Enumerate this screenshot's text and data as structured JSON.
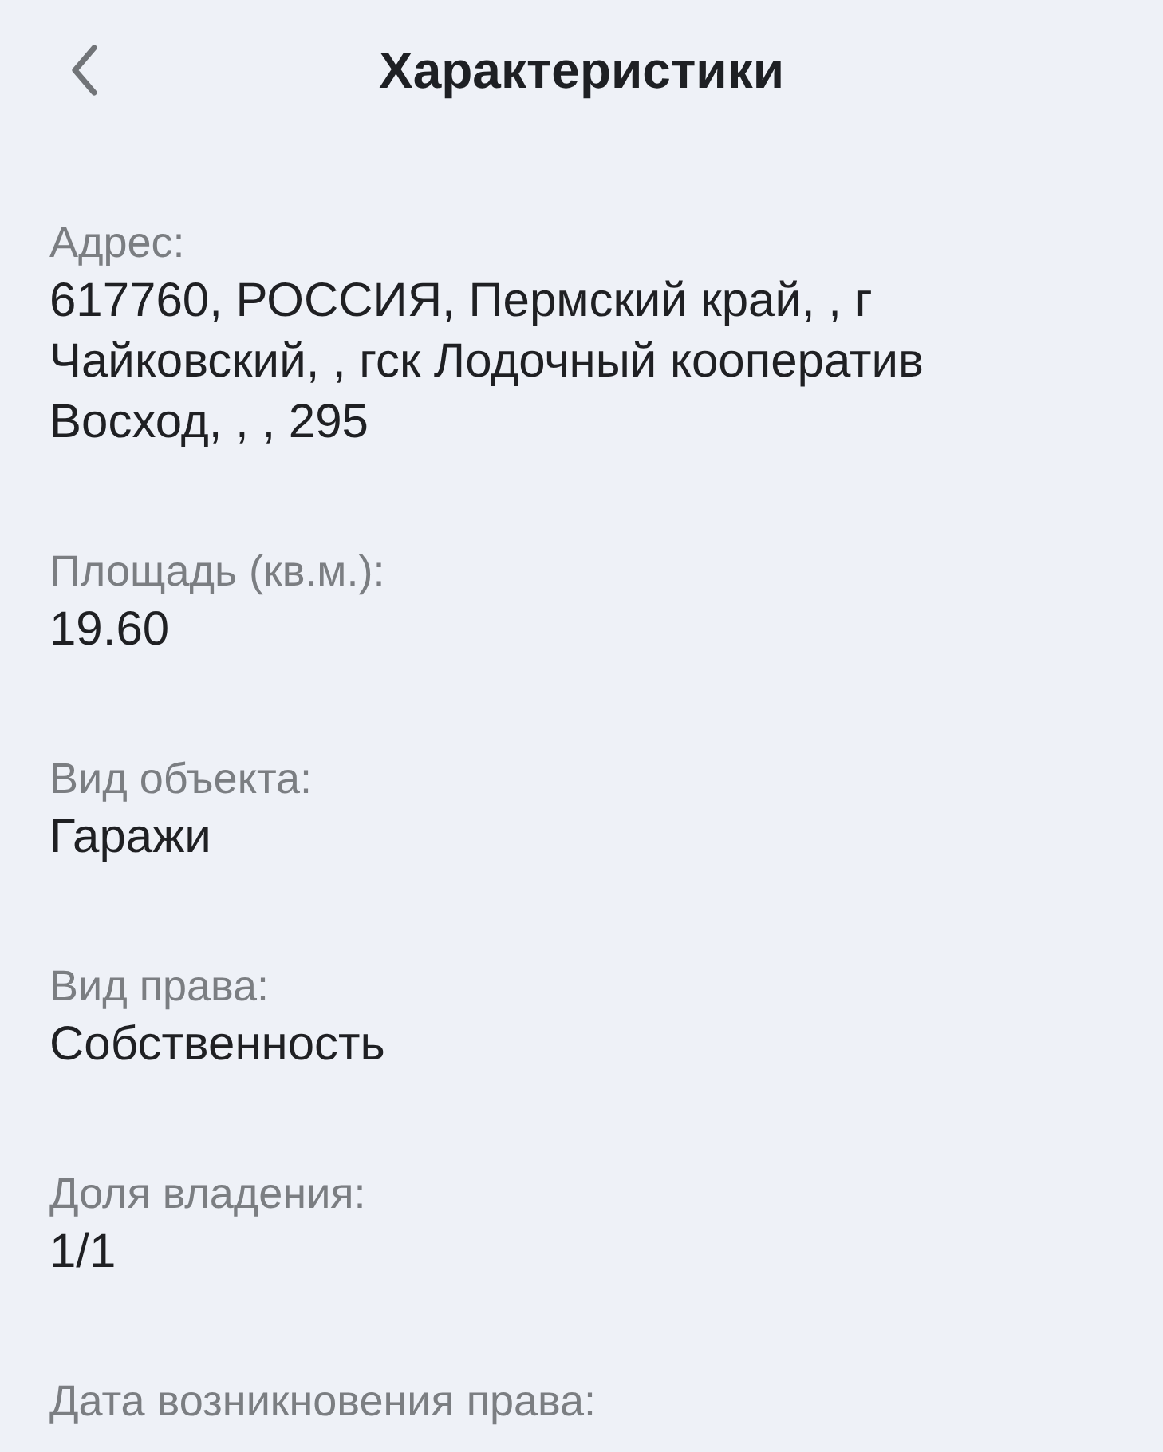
{
  "header": {
    "title": "Характеристики"
  },
  "fields": [
    {
      "label": "Адрес:",
      "value": "617760, РОССИЯ, Пермский край, , г Чайковский, , гск Лодочный кооператив Восход, , , 295"
    },
    {
      "label": "Площадь (кв.м.):",
      "value": "19.60"
    },
    {
      "label": "Вид объекта:",
      "value": "Гаражи"
    },
    {
      "label": "Вид права:",
      "value": "Собственность"
    },
    {
      "label": "Доля владения:",
      "value": "1/1"
    },
    {
      "label": "Дата возникновения права:"
    }
  ]
}
